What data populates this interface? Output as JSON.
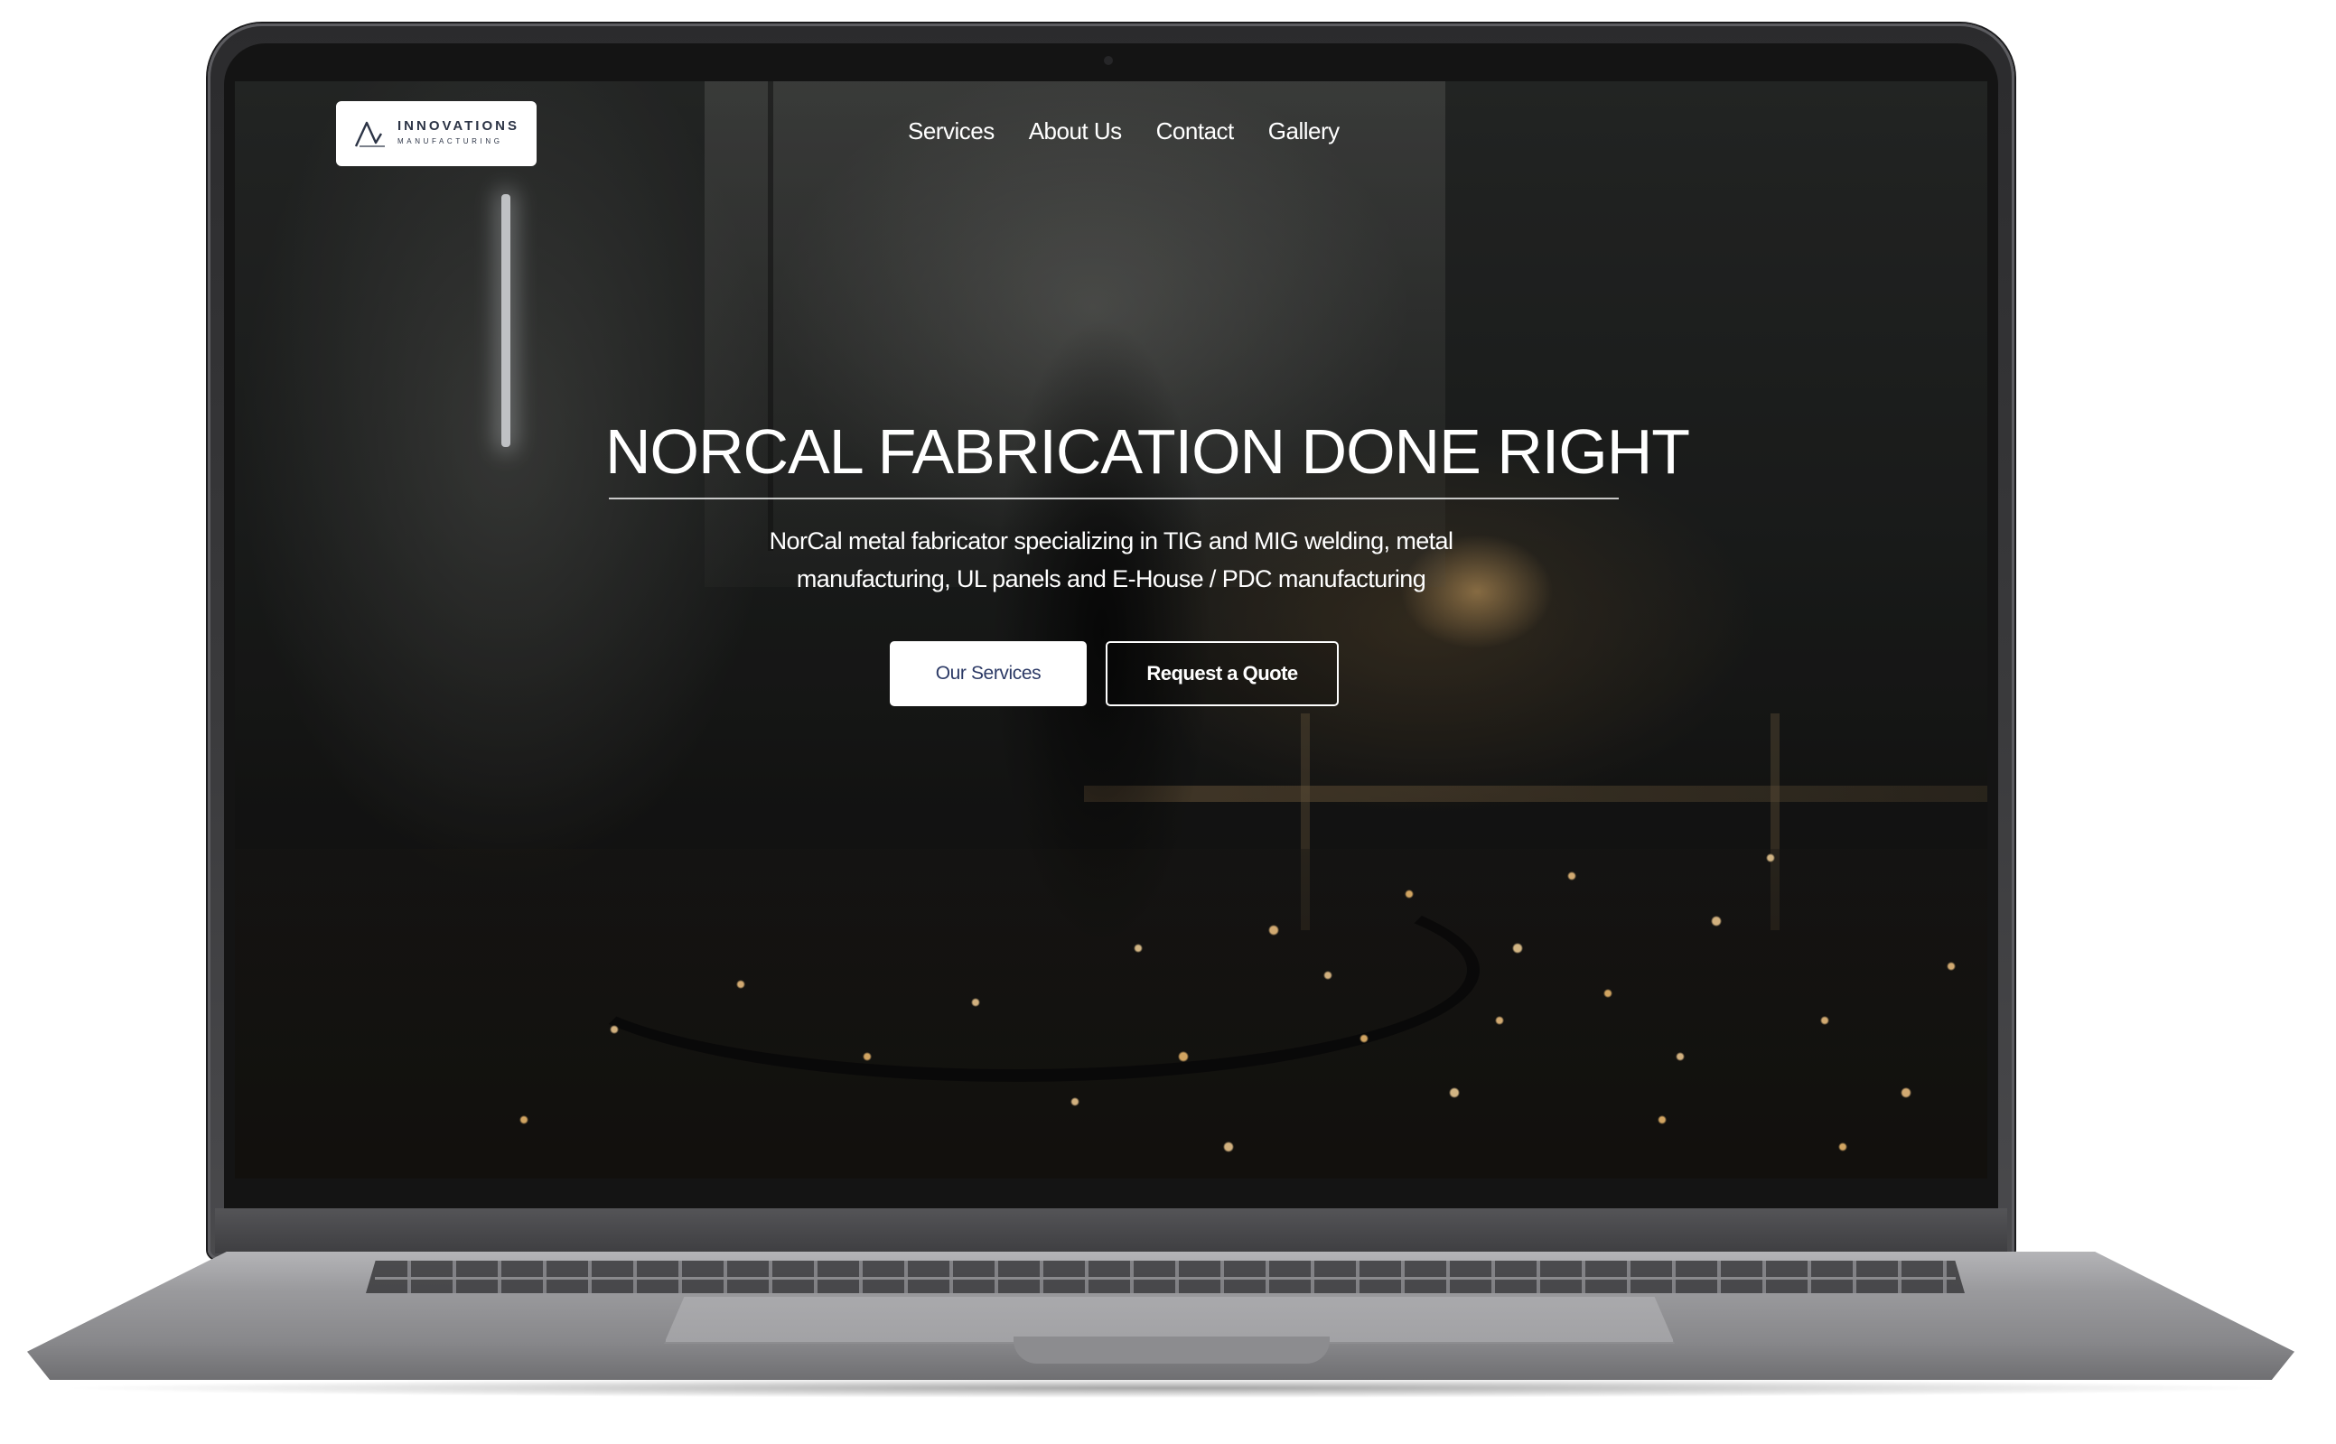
{
  "brand": {
    "name_line1": "INNOVATIONS",
    "name_line2": "MANUFACTURING"
  },
  "nav": {
    "items": [
      {
        "label": "Services"
      },
      {
        "label": "About Us"
      },
      {
        "label": "Contact"
      },
      {
        "label": "Gallery"
      }
    ]
  },
  "hero": {
    "title": "NORCAL FABRICATION DONE RIGHT",
    "subtitle_line1": "NorCal metal fabricator specializing in TIG and MIG welding, metal",
    "subtitle_line2": "manufacturing, UL panels and E-House / PDC manufacturing",
    "primary_button": "Our Services",
    "secondary_button": "Request a Quote"
  },
  "colors": {
    "button_text_primary": "#2c3a66",
    "logo_ink": "#2c3446",
    "laptop_body": "#9a9a9d",
    "bezel": "#141414"
  }
}
